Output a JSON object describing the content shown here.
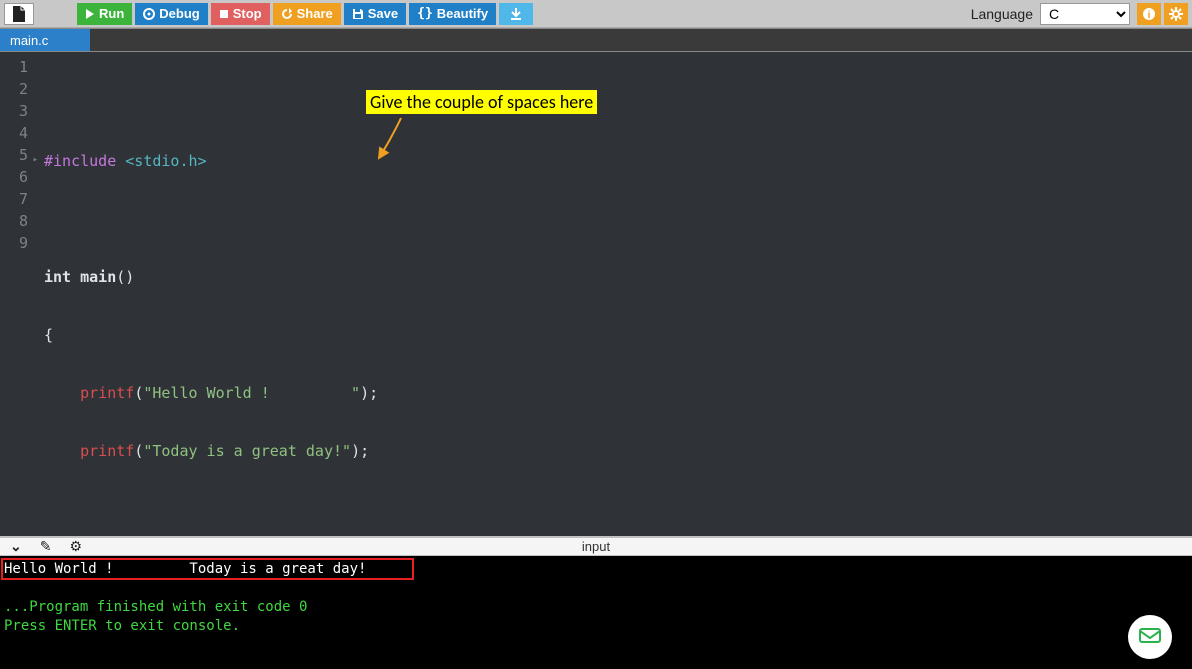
{
  "toolbar": {
    "run": "Run",
    "debug": "Debug",
    "stop": "Stop",
    "share": "Share",
    "save": "Save",
    "beautify": "Beautify",
    "language_label": "Language",
    "language_value": "C"
  },
  "tab": {
    "filename": "main.c"
  },
  "code": {
    "lines": [
      "",
      "#include <stdio.h>",
      "",
      "int main()",
      "{",
      "    printf(\"Hello World !         \");",
      "    printf(\"Today is a great day!\");",
      "",
      "}"
    ],
    "line_numbers": [
      "1",
      "2",
      "3",
      "4",
      "5",
      "6",
      "7",
      "8",
      "9"
    ]
  },
  "annotation": {
    "text": "Give the couple of spaces here"
  },
  "divider": {
    "input_label": "input"
  },
  "console": {
    "output_line": "Hello World !         Today is a great day!",
    "exit_line": "...Program finished with exit code 0",
    "prompt_line": "Press ENTER to exit console."
  }
}
